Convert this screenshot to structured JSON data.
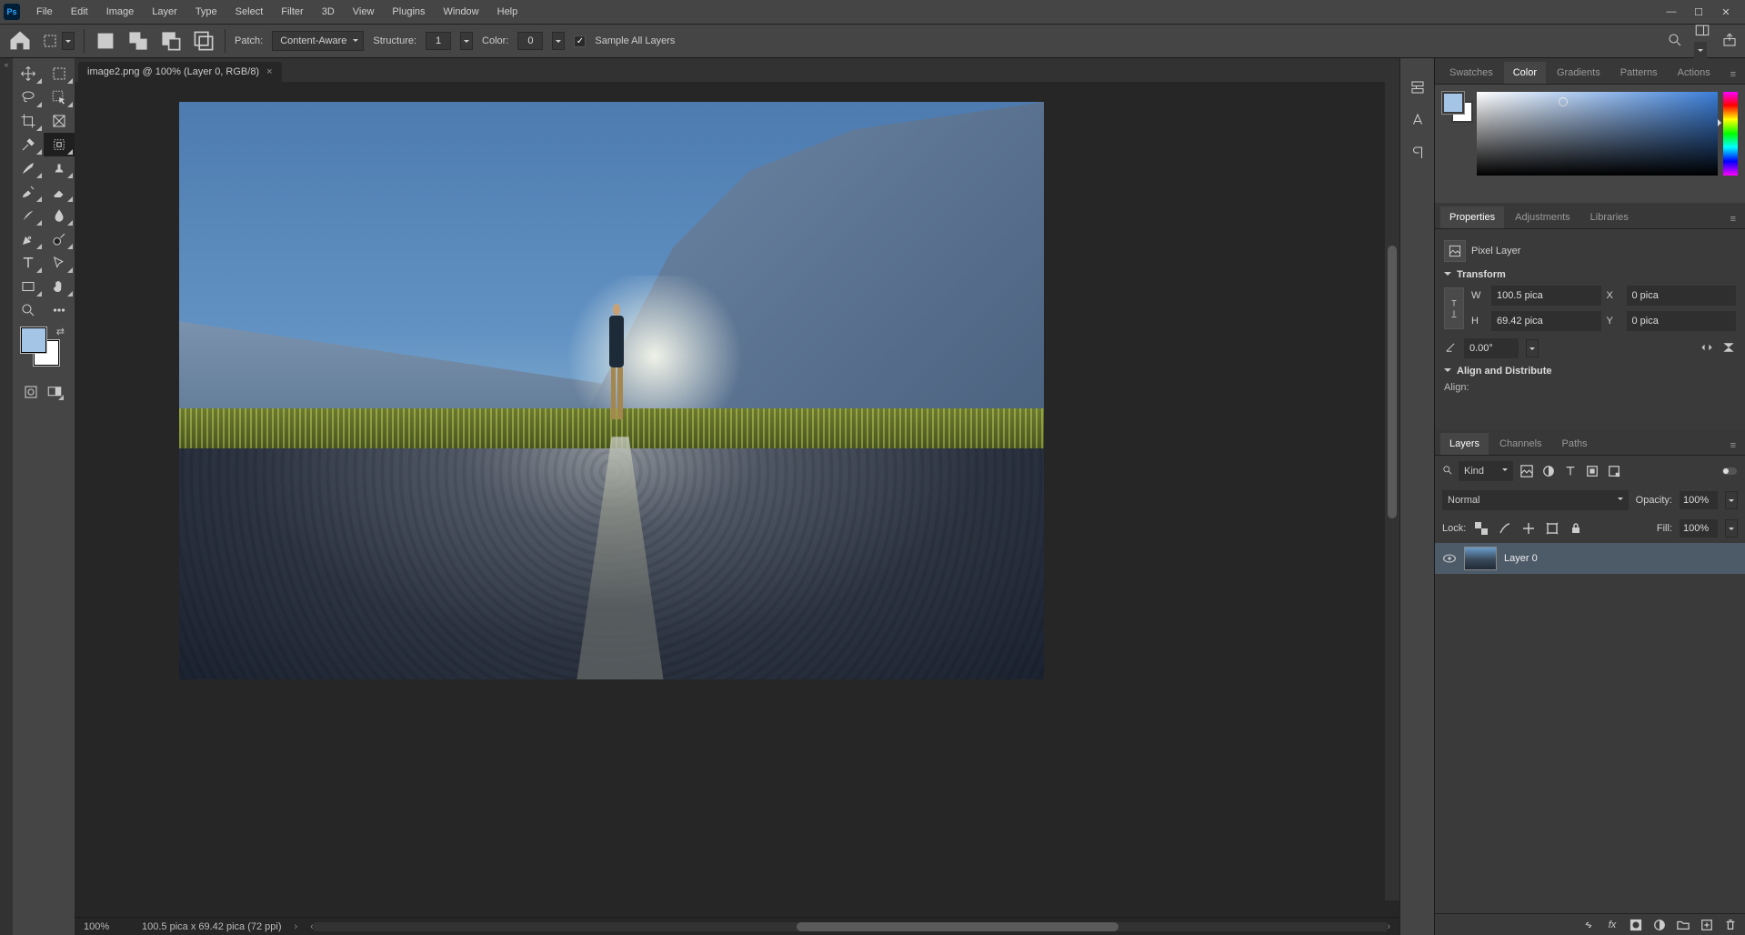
{
  "menu": {
    "items": [
      "File",
      "Edit",
      "Image",
      "Layer",
      "Type",
      "Select",
      "Filter",
      "3D",
      "View",
      "Plugins",
      "Window",
      "Help"
    ]
  },
  "options": {
    "patch_label": "Patch:",
    "patch_mode": "Content-Aware",
    "structure_label": "Structure:",
    "structure_value": "1",
    "color_label": "Color:",
    "color_value": "0",
    "sample_all_label": "Sample All Layers",
    "sample_all_checked": true
  },
  "doc_tab": {
    "title": "image2.png @ 100% (Layer 0, RGB/8)"
  },
  "status": {
    "zoom": "100%",
    "dims": "100.5 pica x 69.42 pica (72 ppi)"
  },
  "right_tabs1": [
    "Swatches",
    "Color",
    "Gradients",
    "Patterns",
    "Actions"
  ],
  "right_tabs1_active": 1,
  "right_tabs2": [
    "Properties",
    "Adjustments",
    "Libraries"
  ],
  "right_tabs2_active": 0,
  "properties": {
    "kind_label": "Pixel Layer",
    "transform_label": "Transform",
    "W_label": "W",
    "W": "100.5 pica",
    "H_label": "H",
    "H": "69.42 pica",
    "X_label": "X",
    "X": "0 pica",
    "Y_label": "Y",
    "Y": "0 pica",
    "angle": "0.00°",
    "align_label": "Align and Distribute",
    "align_sub": "Align:"
  },
  "right_tabs3": [
    "Layers",
    "Channels",
    "Paths"
  ],
  "right_tabs3_active": 0,
  "layers": {
    "kind_dd": "Kind",
    "blend_mode": "Normal",
    "opacity_label": "Opacity:",
    "opacity": "100%",
    "lock_label": "Lock:",
    "fill_label": "Fill:",
    "fill": "100%",
    "items": [
      {
        "name": "Layer 0"
      }
    ]
  }
}
